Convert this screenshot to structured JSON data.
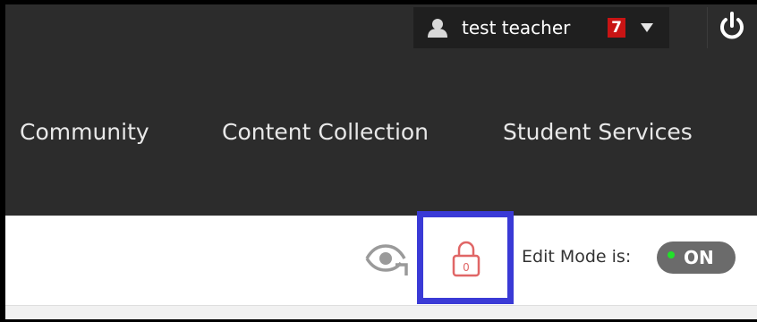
{
  "user_menu": {
    "user_name": "test teacher",
    "notification_count": "7"
  },
  "nav": {
    "items": [
      {
        "label": "Community"
      },
      {
        "label": "Content Collection"
      },
      {
        "label": "Student Services"
      }
    ]
  },
  "toolbar": {
    "lock_count": "0",
    "edit_mode_label": "Edit Mode is:",
    "edit_mode_state": "ON"
  },
  "icons": {
    "user": "user-icon",
    "power": "power-icon",
    "eye": "student-preview-icon",
    "lock": "lock-icon",
    "caret": "caret-down-icon"
  },
  "colors": {
    "header_bg": "#2c2c2c",
    "userbar_bg": "#1f1f1f",
    "badge_bg": "#c81414",
    "lock_red": "#e06666",
    "highlight_box": "#3a3ad6",
    "toggle_bg": "#6b6b6b",
    "toggle_dot": "#22e02a"
  }
}
